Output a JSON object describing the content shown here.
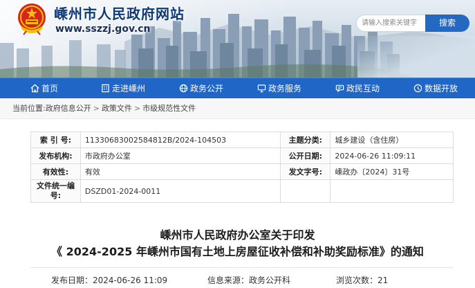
{
  "header": {
    "site_title": "嵊州市人民政府网站",
    "site_url": "www.sszzj.gov.cn",
    "search_placeholder": "请输入搜索关键字",
    "search_button": "搜索"
  },
  "nav": {
    "items": [
      {
        "label": "首页",
        "icon": "home-icon"
      },
      {
        "label": "走进嵊州",
        "icon": "building-icon"
      },
      {
        "label": "政务公开",
        "icon": "globe-icon"
      },
      {
        "label": "政务服务",
        "icon": "monitor-icon"
      },
      {
        "label": "政民互动",
        "icon": "chat-icon"
      },
      {
        "label": "数据开放",
        "icon": "database-icon"
      }
    ]
  },
  "breadcrumb": {
    "prefix": "当前位置:",
    "items": [
      "政府信息公开",
      "政策文件",
      "市级规范性文件"
    ],
    "separator": ">"
  },
  "info": {
    "index_no_label": "索 引 号:",
    "index_no": "11330683002584812B/2024-104503",
    "topic_label": "主题分类:",
    "topic": "城乡建设（含住房）",
    "issuer_label": "发布机构:",
    "issuer": "市政府办公室",
    "pub_date_label": "公开日期:",
    "pub_date": "2024-06-26 11:09:11",
    "validity_label": "有效性:",
    "validity": "有效",
    "doc_no_label": "发文字号:",
    "doc_no": "嵊政办〔2024〕31号",
    "unified_no_label": "文件统一编号:",
    "unified_no": "DSZD01-2024-0011"
  },
  "article": {
    "title_line1": "嵊州市人民政府办公室关于印发",
    "title_line2": "《 2024-2025 年嵊州市国有土地上房屋征收补偿和补助奖励标准》的通知",
    "publish_date": "发布日期：2024-06-26 11:09",
    "source": "信息来源：政务公开科",
    "views": "浏览次数：21"
  },
  "colors": {
    "brand_blue": "#1f66c6",
    "title_blue": "#0e3a77",
    "search_blue": "#2468c2"
  }
}
